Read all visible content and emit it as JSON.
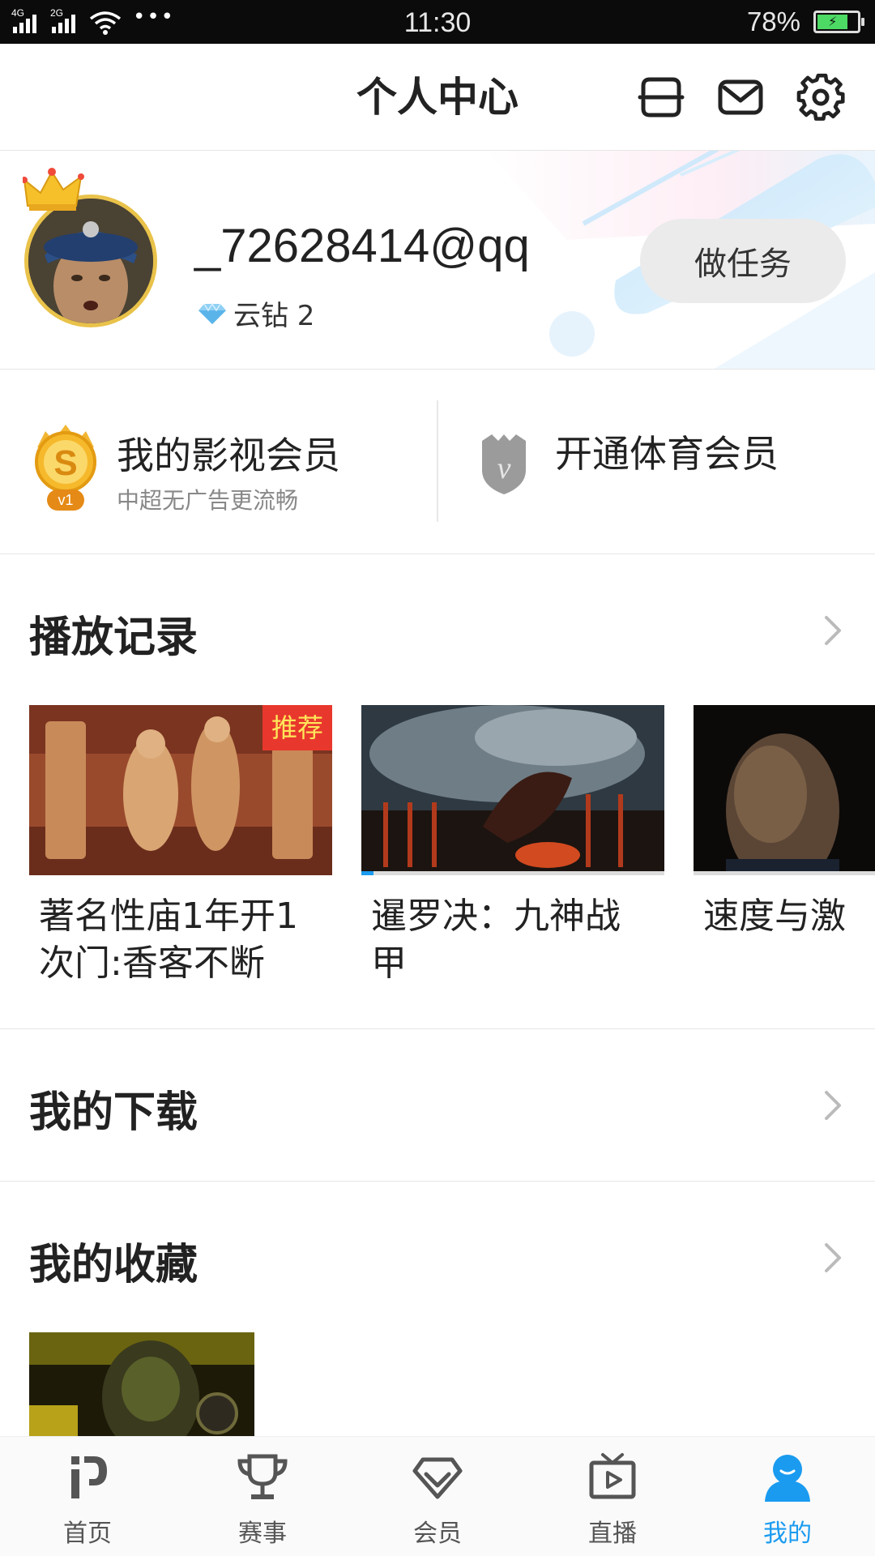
{
  "status_bar": {
    "signal1_label": "4G",
    "signal2_label": "2G",
    "more": "•••",
    "time": "11:30",
    "battery_percent": "78%",
    "battery_level": 0.78
  },
  "header": {
    "title": "个人中心",
    "icons": [
      "scan-icon",
      "mail-icon",
      "gear-icon"
    ]
  },
  "profile": {
    "username": "_72628414@qq",
    "coin_label": "云钻 2",
    "task_button": "做任务"
  },
  "membership": {
    "video": {
      "title": "我的影视会员",
      "subtitle": "中超无广告更流畅",
      "level": "v1"
    },
    "sports": {
      "title": "开通体育会员"
    }
  },
  "history": {
    "title": "播放记录",
    "items": [
      {
        "title": "著名性庙1年开1次门:香客不断",
        "badge": "推荐",
        "progress": 0
      },
      {
        "title": "暹罗决：九神战甲",
        "progress": 0.04
      },
      {
        "title": "速度与激",
        "progress": 0
      }
    ]
  },
  "downloads": {
    "title": "我的下载"
  },
  "favorites": {
    "title": "我的收藏"
  },
  "bottom_nav": [
    {
      "label": "首页",
      "icon": "home-logo-icon",
      "active": false
    },
    {
      "label": "赛事",
      "icon": "trophy-icon",
      "active": false
    },
    {
      "label": "会员",
      "icon": "diamond-icon",
      "active": false
    },
    {
      "label": "直播",
      "icon": "tv-play-icon",
      "active": false
    },
    {
      "label": "我的",
      "icon": "person-icon",
      "active": true
    }
  ],
  "colors": {
    "accent": "#1a9bf0",
    "badge_bg": "#e8382d",
    "badge_text": "#ffe65a"
  }
}
